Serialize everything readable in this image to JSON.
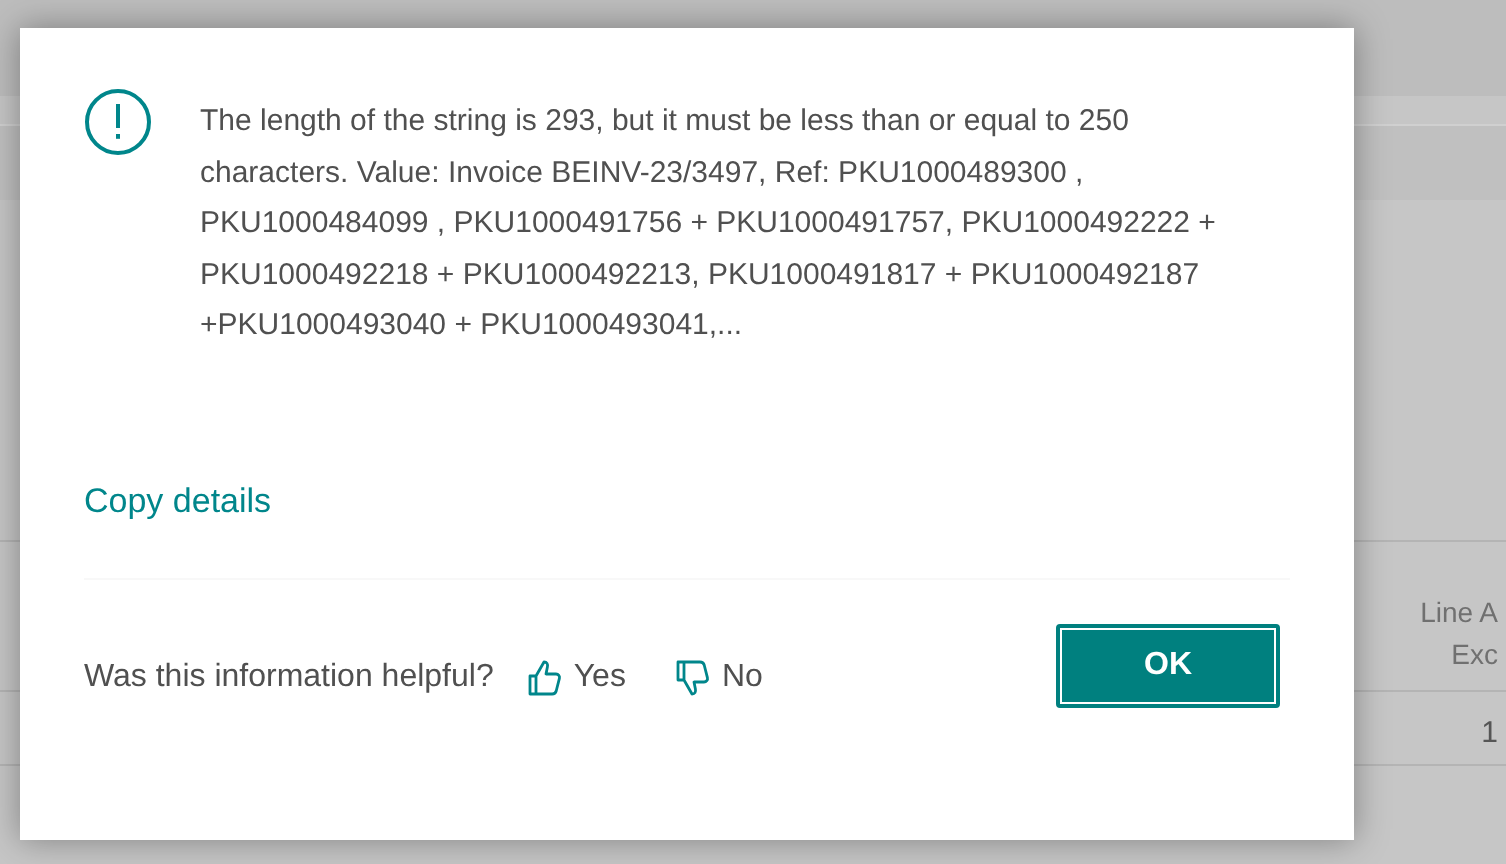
{
  "background": {
    "column_header": [
      "Line A",
      "Exc"
    ],
    "cell": "1"
  },
  "dialog": {
    "message": "The length of the string is 293, but it must be less than or equal to 250 characters. Value: Invoice BEINV-23/3497, Ref: PKU1000489300 , PKU1000484099 , PKU1000491756 + PKU1000491757, PKU1000492222 + PKU1000492218 + PKU1000492213, PKU1000491817 + PKU1000492187 +PKU1000493040 + PKU1000493041,...",
    "copy_link": "Copy details",
    "feedback_question": "Was this information helpful?",
    "feedback": [
      {
        "kind": "up",
        "label": "Yes"
      },
      {
        "kind": "down",
        "label": "No"
      }
    ],
    "ok_button": "OK"
  }
}
